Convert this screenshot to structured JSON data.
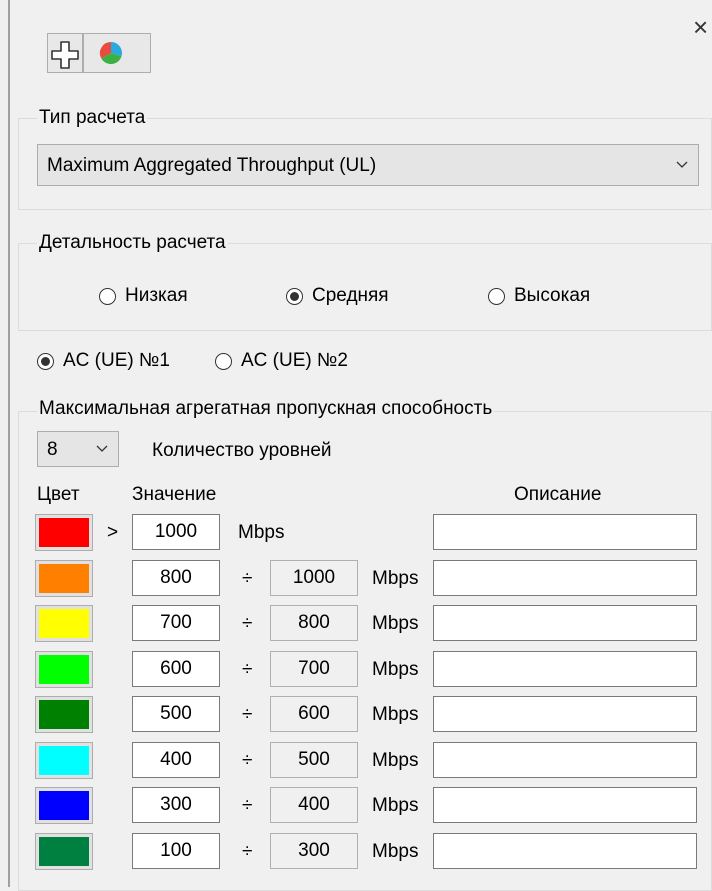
{
  "window": {
    "close_glyph": "×"
  },
  "toolbar": {
    "add_icon": "plus-outline-icon",
    "color_icon": "color-wheel-icon"
  },
  "calc_type": {
    "label": "Тип расчета",
    "selected": "Maximum Aggregated Throughput (UL)"
  },
  "detail": {
    "label": "Детальность расчета",
    "options": [
      "Низкая",
      "Средняя",
      "Высокая"
    ],
    "selected_index": 1
  },
  "ue": {
    "options": [
      "AC (UE) №1",
      "AC (UE) №2"
    ],
    "selected_index": 0
  },
  "levels": {
    "group_label": "Максимальная агрегатная пропускная способность",
    "count": "8",
    "count_label": "Количество уровней",
    "col_color": "Цвет",
    "col_value": "Значение",
    "col_desc": "Описание",
    "gt": ">",
    "div": "÷",
    "unit": "Mbps",
    "rows": [
      {
        "color": "#ff0000",
        "from": "1000",
        "to": ""
      },
      {
        "color": "#ff8000",
        "from": "800",
        "to": "1000"
      },
      {
        "color": "#ffff00",
        "from": "700",
        "to": "800"
      },
      {
        "color": "#00ff00",
        "from": "600",
        "to": "700"
      },
      {
        "color": "#008000",
        "from": "500",
        "to": "600"
      },
      {
        "color": "#00ffff",
        "from": "400",
        "to": "500"
      },
      {
        "color": "#0000ff",
        "from": "300",
        "to": "400"
      },
      {
        "color": "#008040",
        "from": "100",
        "to": "300"
      }
    ]
  }
}
